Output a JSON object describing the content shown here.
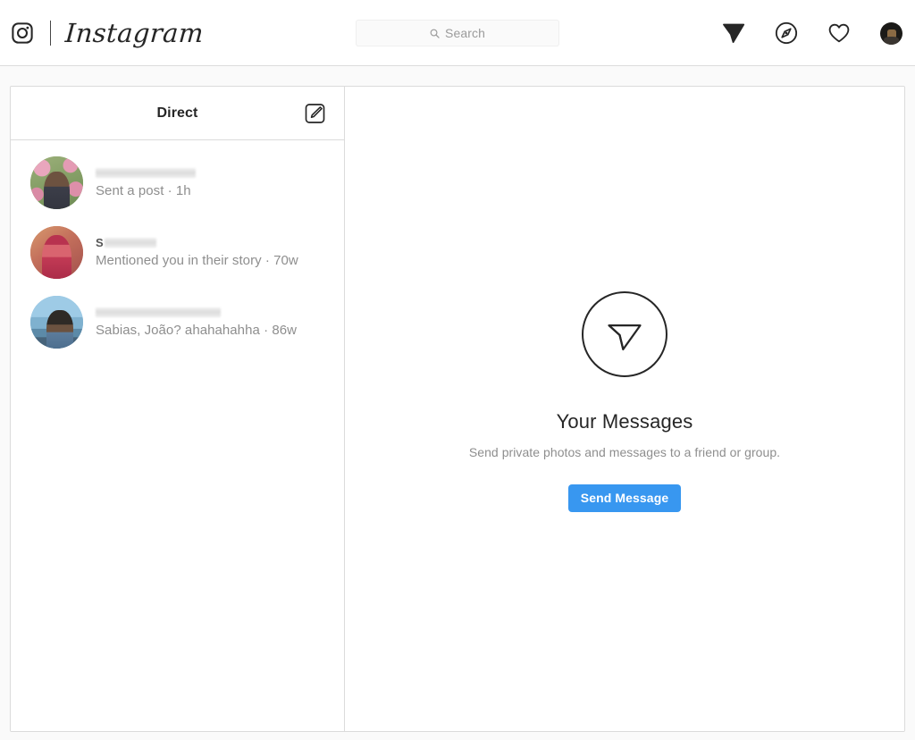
{
  "nav": {
    "logo_icon": "instagram-camera-icon",
    "wordmark": "Instagram",
    "search": {
      "placeholder": "Search",
      "value": "",
      "icon": "search-icon"
    },
    "icons": [
      {
        "name": "direct-messages-icon",
        "glyph": "paper-plane-filled"
      },
      {
        "name": "explore-icon",
        "glyph": "compass-outline"
      },
      {
        "name": "activity-icon",
        "glyph": "heart-outline"
      }
    ],
    "avatar_label": "profile-avatar"
  },
  "threads_panel": {
    "title": "Direct",
    "compose_icon": "new-message-pencil-icon",
    "threads": [
      {
        "username": "",
        "username_redacted": true,
        "redaction_width": "w1",
        "preview": "Sent a post · 1h",
        "avatar": "av-a"
      },
      {
        "username": "S",
        "username_redacted": true,
        "redaction_width": "w2",
        "preview": "Mentioned you in their story · 70w",
        "avatar": "av-b"
      },
      {
        "username": "",
        "username_redacted": true,
        "redaction_width": "w3",
        "preview": "Sabias, João? ahahahahha · 86w",
        "avatar": "av-c"
      }
    ]
  },
  "empty_state": {
    "icon": "send-message-circle-icon",
    "title": "Your Messages",
    "subtitle": "Send private photos and messages to a friend or group.",
    "button_label": "Send Message"
  },
  "colors": {
    "accent_blue": "#3897f0",
    "page_background": "#fafafa",
    "card_background": "#ffffff",
    "border": "#dbdbdb",
    "text_primary": "#262626",
    "text_secondary": "#8e8e8e"
  }
}
